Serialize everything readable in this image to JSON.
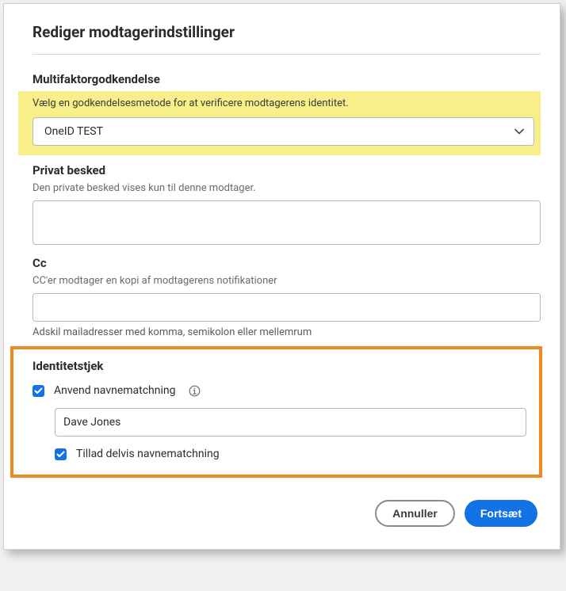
{
  "dialog": {
    "title": "Rediger modtagerindstillinger"
  },
  "mfa": {
    "heading": "Multifaktorgodkendelse",
    "helper": "Vælg en godkendelsesmetode for at verificere modtagerens identitet.",
    "selected": "OneID TEST"
  },
  "privateMessage": {
    "heading": "Privat besked",
    "helper": "Den private besked vises kun til denne modtager.",
    "value": ""
  },
  "cc": {
    "heading": "Cc",
    "helper": "CC'er modtager en kopi af modtagerens notifikationer",
    "value": "",
    "hint": "Adskil mailadresser med komma, semikolon eller mellemrum"
  },
  "identity": {
    "heading": "Identitetstjek",
    "useNameMatchLabel": "Anvend navnematchning",
    "nameValue": "Dave Jones",
    "allowPartialLabel": "Tillad delvis navnematchning"
  },
  "buttons": {
    "cancel": "Annuller",
    "continue": "Fortsæt"
  }
}
